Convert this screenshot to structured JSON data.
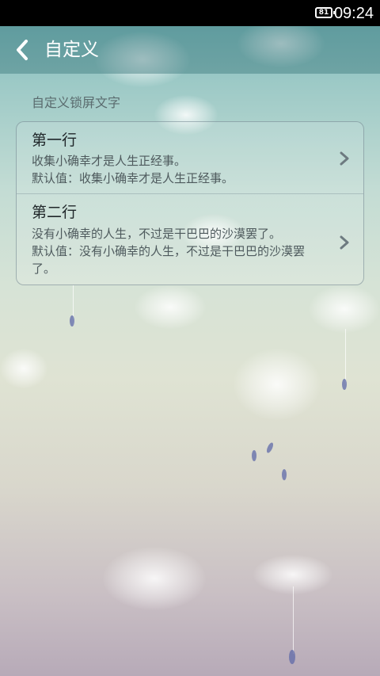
{
  "status_bar": {
    "battery": "81",
    "time": "09:24"
  },
  "header": {
    "title": "自定义"
  },
  "section": {
    "label": "自定义锁屏文字"
  },
  "rows": [
    {
      "title": "第一行",
      "value": "收集小确幸才是人生正经事。",
      "default": "默认值：收集小确幸才是人生正经事。"
    },
    {
      "title": "第二行",
      "value": "没有小确幸的人生，不过是干巴巴的沙漠罢了。",
      "default": "默认值：没有小确幸的人生，不过是干巴巴的沙漠罢了。"
    }
  ],
  "icons": {
    "back": "chevron-left-icon",
    "row_arrow": "chevron-right-icon"
  }
}
